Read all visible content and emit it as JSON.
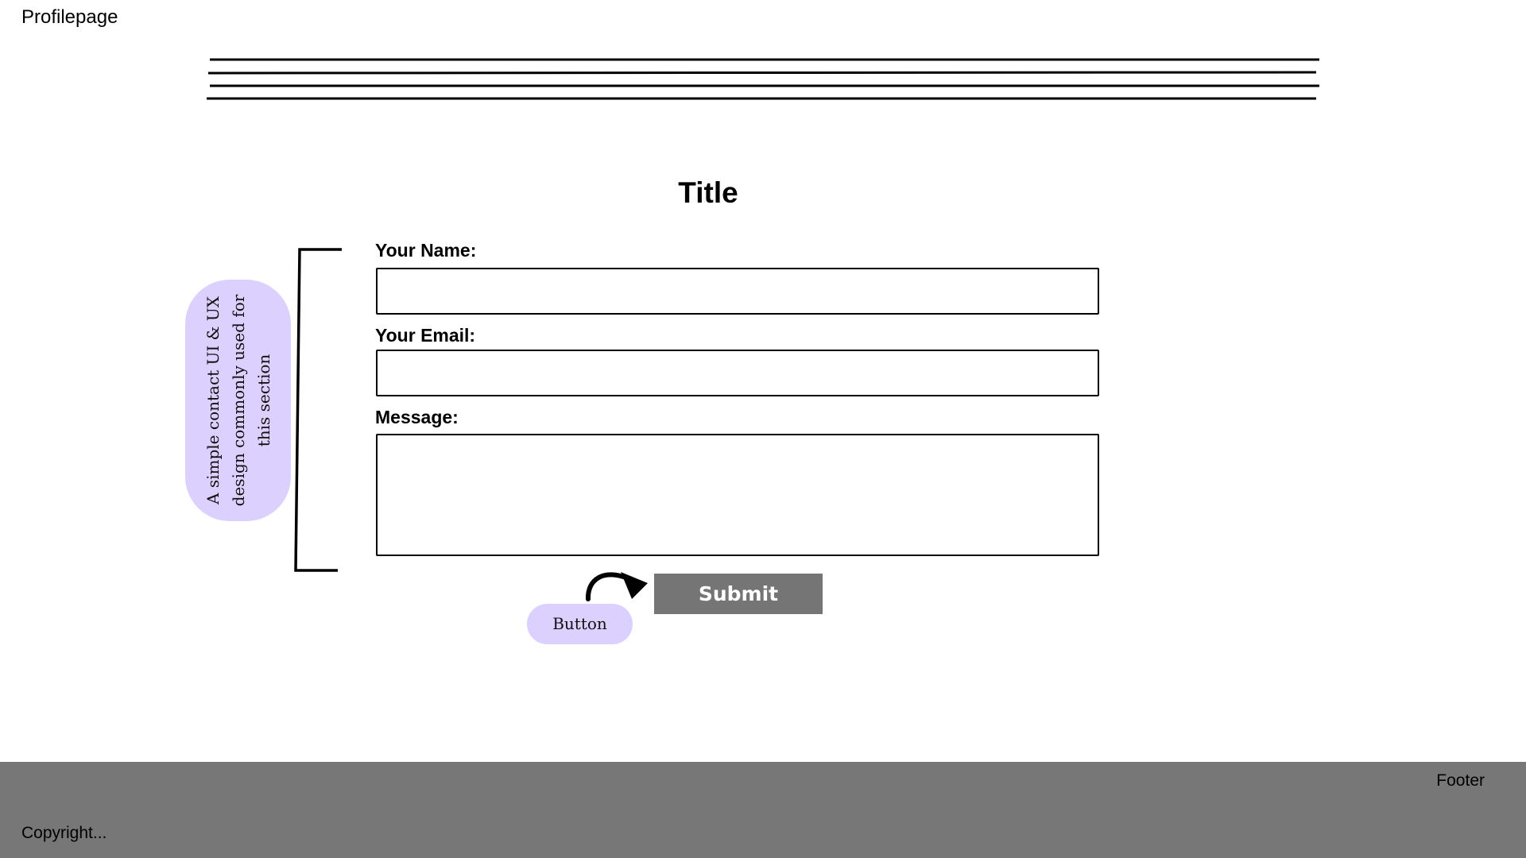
{
  "header": {
    "page_label": "Profilepage"
  },
  "hero": {
    "placeholder_lines": 4
  },
  "contact": {
    "title": "Title",
    "name_label": "Your Name:",
    "name_value": "",
    "email_label": "Your Email:",
    "email_value": "",
    "message_label": "Message:",
    "message_value": "",
    "submit_label": "Submit"
  },
  "annotations": {
    "section_note": "A simple contact UI & UX design commonly used for this section",
    "button_note": "Button",
    "callout_color": "#dcd0fe",
    "button_color": "#757575",
    "footer_color": "#777777",
    "arrow_icon": "curved-arrow-icon",
    "bracket_icon": "bracket-icon"
  },
  "footer": {
    "label": "Footer",
    "copyright": "Copyright..."
  }
}
